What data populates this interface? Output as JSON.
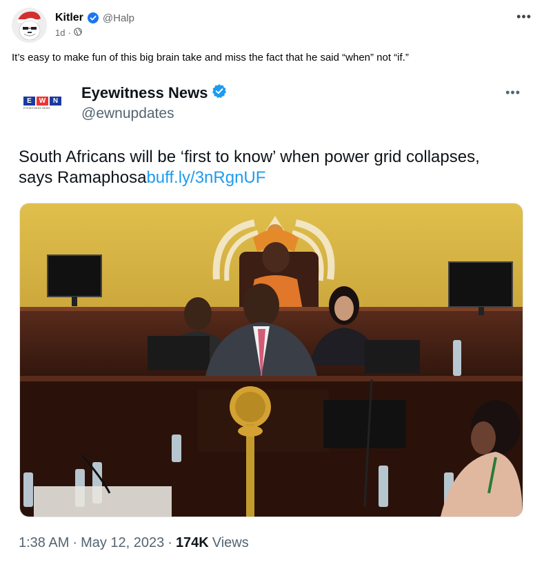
{
  "post": {
    "author": "Kitler",
    "handle": "@Halp",
    "time": "1d",
    "separator": "·",
    "more": "•••",
    "caption": "It’s easy to make fun of this big brain take and miss the fact that he said “when” not “if.”"
  },
  "tweet": {
    "logo": {
      "letters": [
        "E",
        "W",
        "N"
      ],
      "tagline": "EYEWITNESS NEWS"
    },
    "name": "Eyewitness News",
    "handle": "@ewnupdates",
    "more": "•••",
    "text": "South Africans will be ‘first to know’ when power grid collapses, says Ramaphosa",
    "link": "buff.ly/3nRgnUF",
    "time": "1:38 AM",
    "date": "May 12, 2023",
    "views_count": "174K",
    "views_label": "Views",
    "separator": "·"
  },
  "icons": {
    "verified": "verified-badge-icon",
    "globe": "globe-icon",
    "more": "more-icon"
  },
  "colors": {
    "verified_blue": "#1d9bf0",
    "link_blue": "#1d9bf0",
    "fb_verified": "#1877f2"
  }
}
